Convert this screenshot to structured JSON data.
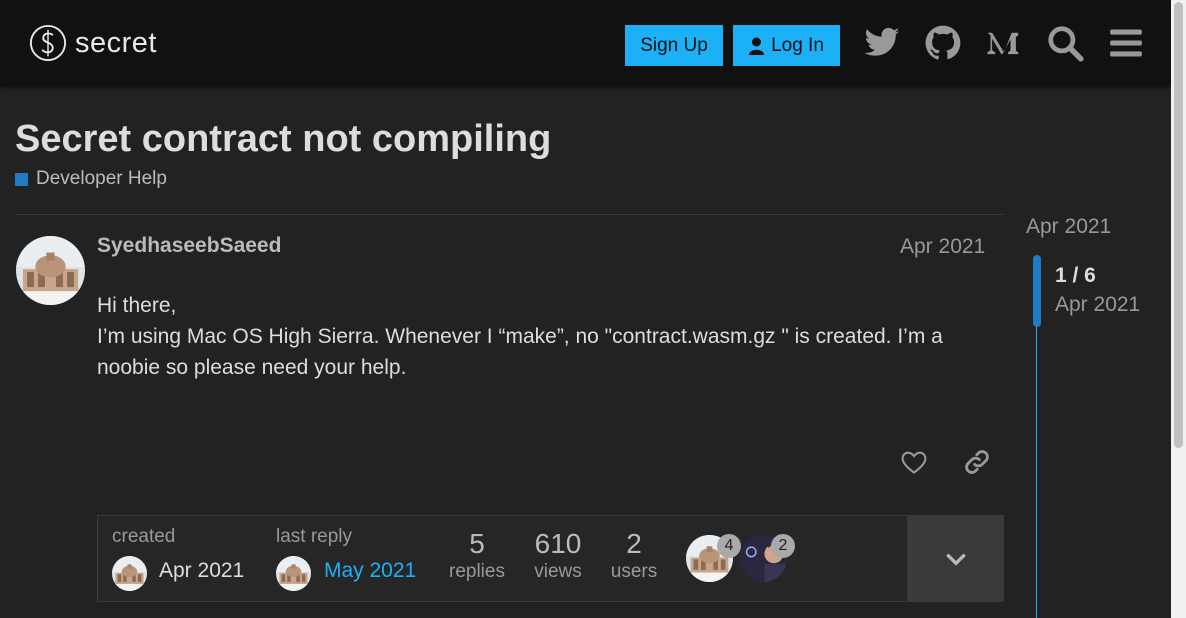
{
  "header": {
    "logo_text": "secret",
    "signup_label": "Sign Up",
    "login_label": "Log In",
    "icons": [
      "twitter-icon",
      "github-icon",
      "medium-icon",
      "search-icon",
      "hamburger-menu-icon"
    ],
    "accent_color": "#1cb0f6"
  },
  "topic": {
    "title": "Secret contract not compiling",
    "category": "Developer Help",
    "category_color": "#1f7bc6"
  },
  "post": {
    "username": "SyedhaseebSaeed",
    "date": "Apr 2021",
    "body": [
      "Hi there,",
      "I’m using Mac OS High Sierra. Whenever I “make”, no \"contract.wasm.gz \" is created. I’m a noobie so please need your help."
    ]
  },
  "topic_map": {
    "created_label": "created",
    "created_date": "Apr 2021",
    "last_reply_label": "last reply",
    "last_reply_date": "May 2021",
    "replies_count": "5",
    "replies_label": "replies",
    "views_count": "610",
    "views_label": "views",
    "users_count": "2",
    "users_label": "users",
    "participants": [
      {
        "post_count": "4"
      },
      {
        "post_count": "2"
      }
    ]
  },
  "timeline": {
    "start_date": "Apr 2021",
    "position": "1 / 6",
    "current_date": "Apr 2021"
  }
}
